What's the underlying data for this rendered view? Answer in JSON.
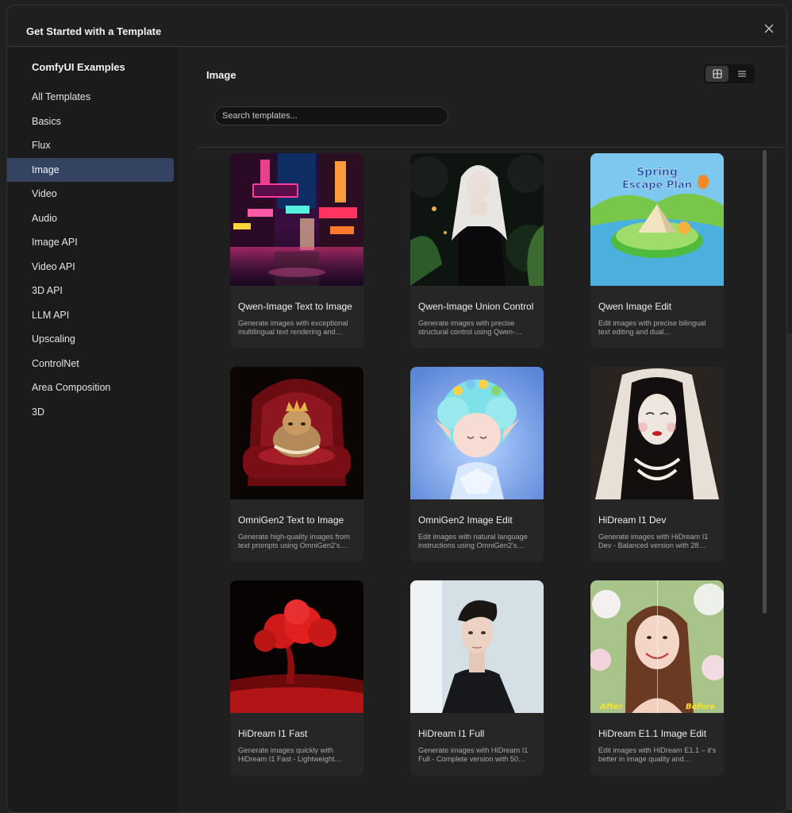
{
  "dialog": {
    "title": "Get Started with a Template",
    "close_icon": "close-icon"
  },
  "sidebar": {
    "title": "ComfyUI Examples",
    "items": [
      {
        "label": "All Templates",
        "active": false
      },
      {
        "label": "Basics",
        "active": false
      },
      {
        "label": "Flux",
        "active": false
      },
      {
        "label": "Image",
        "active": true
      },
      {
        "label": "Video",
        "active": false
      },
      {
        "label": "Audio",
        "active": false
      },
      {
        "label": "Image API",
        "active": false
      },
      {
        "label": "Video API",
        "active": false
      },
      {
        "label": "3D API",
        "active": false
      },
      {
        "label": "LLM API",
        "active": false
      },
      {
        "label": "Upscaling",
        "active": false
      },
      {
        "label": "ControlNet",
        "active": false
      },
      {
        "label": "Area Composition",
        "active": false
      },
      {
        "label": "3D",
        "active": false
      }
    ]
  },
  "main": {
    "title": "Image",
    "search": {
      "placeholder": "Search templates...",
      "value": ""
    },
    "view_toggle": {
      "grid_icon": "grid-view-icon",
      "list_icon": "list-view-icon",
      "selected": "grid"
    },
    "cards": [
      {
        "title": "Qwen-Image Text to Image",
        "desc": "Generate images with exceptional multilingual text rendering and…",
        "thumb": "neon-street"
      },
      {
        "title": "Qwen-Image Union Control",
        "desc": "Generate images with precise structural control using Qwen-…",
        "thumb": "pale-girl"
      },
      {
        "title": "Qwen Image Edit",
        "desc": "Edit images with precise bilingual text editing and dual…",
        "thumb": "spring-poster",
        "poster_title": "Spring Escape Plan"
      },
      {
        "title": "OmniGen2 Text to Image",
        "desc": "Generate high-quality images from text prompts using OmniGen2's…",
        "thumb": "cat-throne"
      },
      {
        "title": "OmniGen2 Image Edit",
        "desc": "Edit images with natural language instructions using OmniGen2's…",
        "thumb": "crystal-elf"
      },
      {
        "title": "HiDream I1 Dev",
        "desc": "Generate images with HiDream I1 Dev - Balanced version with 28…",
        "thumb": "veiled-woman"
      },
      {
        "title": "HiDream I1 Fast",
        "desc": "Generate images quickly with HiDream I1 Fast - Lightweight…",
        "thumb": "red-tree"
      },
      {
        "title": "HiDream I1 Full",
        "desc": "Generate images with HiDream I1 Full - Complete version with 50…",
        "thumb": "portrait-man"
      },
      {
        "title": "HiDream E1.1 Image Edit",
        "desc": "Edit images with HiDream E1.1 – it's better in image quality and…",
        "thumb": "smiling-woman",
        "labels": [
          "After",
          "Before"
        ]
      }
    ]
  }
}
